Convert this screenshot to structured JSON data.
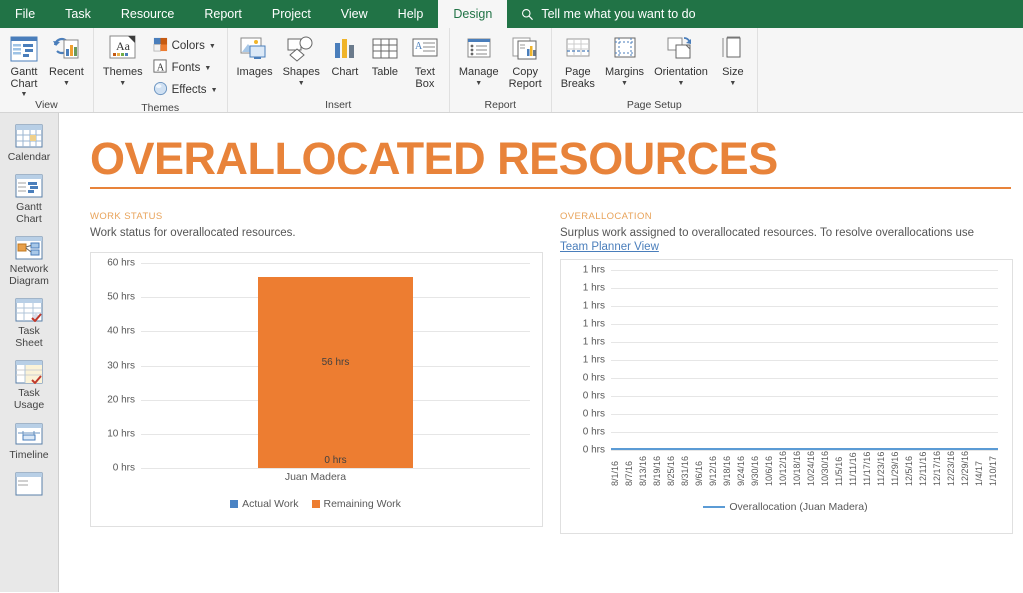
{
  "ribbon": {
    "tabs": [
      {
        "label": "File",
        "active": false
      },
      {
        "label": "Task",
        "active": false
      },
      {
        "label": "Resource",
        "active": false
      },
      {
        "label": "Report",
        "active": false
      },
      {
        "label": "Project",
        "active": false
      },
      {
        "label": "View",
        "active": false
      },
      {
        "label": "Help",
        "active": false
      },
      {
        "label": "Design",
        "active": true
      }
    ],
    "tell_me": "Tell me what you want to do",
    "tell_me_icon": "search-icon",
    "groups": [
      {
        "name": "View",
        "buttons": [
          {
            "label": "Gantt\nChart",
            "icon": "gantt-chart-icon",
            "dropdown": true
          },
          {
            "label": "Recent",
            "icon": "recent-icon",
            "dropdown": true
          }
        ]
      },
      {
        "name": "Themes",
        "buttons": [
          {
            "label": "Themes",
            "icon": "themes-icon",
            "dropdown": true
          }
        ],
        "small_buttons": [
          {
            "label": "Colors",
            "icon": "colors-icon",
            "dropdown": true
          },
          {
            "label": "Fonts",
            "icon": "fonts-icon",
            "dropdown": true
          },
          {
            "label": "Effects",
            "icon": "effects-icon",
            "dropdown": true
          }
        ]
      },
      {
        "name": "Insert",
        "buttons": [
          {
            "label": "Images",
            "icon": "images-icon",
            "dropdown": false
          },
          {
            "label": "Shapes",
            "icon": "shapes-icon",
            "dropdown": true
          },
          {
            "label": "Chart",
            "icon": "chart-icon",
            "dropdown": false
          },
          {
            "label": "Table",
            "icon": "table-icon",
            "dropdown": false
          },
          {
            "label": "Text\nBox",
            "icon": "text-box-icon",
            "dropdown": false
          }
        ]
      },
      {
        "name": "Report",
        "buttons": [
          {
            "label": "Manage",
            "icon": "manage-icon",
            "dropdown": true
          },
          {
            "label": "Copy\nReport",
            "icon": "copy-report-icon",
            "dropdown": false
          }
        ]
      },
      {
        "name": "Page Setup",
        "buttons": [
          {
            "label": "Page\nBreaks",
            "icon": "page-breaks-icon",
            "dropdown": false
          },
          {
            "label": "Margins",
            "icon": "margins-icon",
            "dropdown": true
          },
          {
            "label": "Orientation",
            "icon": "orientation-icon",
            "dropdown": true
          },
          {
            "label": "Size",
            "icon": "size-icon",
            "dropdown": true
          }
        ]
      }
    ]
  },
  "sidebar": {
    "items": [
      {
        "label": "Calendar",
        "icon": "calendar-view-icon"
      },
      {
        "label": "Gantt\nChart",
        "icon": "gantt-chart-view-icon"
      },
      {
        "label": "Network\nDiagram",
        "icon": "network-diagram-view-icon"
      },
      {
        "label": "Task\nSheet",
        "icon": "task-sheet-view-icon"
      },
      {
        "label": "Task\nUsage",
        "icon": "task-usage-view-icon"
      },
      {
        "label": "Timeline",
        "icon": "timeline-view-icon"
      },
      {
        "label": "",
        "icon": "partial-view-icon"
      }
    ]
  },
  "report": {
    "title": "OVERALLOCATED RESOURCES",
    "accent_color": "#E8833A",
    "panels": [
      {
        "heading": "WORK STATUS",
        "description": "Work status for overallocated resources.",
        "link": null
      },
      {
        "heading": "OVERALLOCATION",
        "description": "Surplus work assigned to overallocated resources. To resolve overallocations use",
        "link": "Team Planner View"
      }
    ]
  },
  "chart_data": [
    {
      "type": "bar",
      "title": "Work Status",
      "categories": [
        "Juan Madera"
      ],
      "series": [
        {
          "name": "Actual Work",
          "values": [
            0
          ],
          "color": "#4A83C4",
          "labels": [
            "0 hrs"
          ]
        },
        {
          "name": "Remaining Work",
          "values": [
            56
          ],
          "color": "#ED7D31",
          "labels": [
            "56 hrs"
          ]
        }
      ],
      "stacked": true,
      "ylabel": "",
      "xlabel": "",
      "ylim": [
        0,
        60
      ],
      "yticks": [
        "0 hrs",
        "10 hrs",
        "20 hrs",
        "30 hrs",
        "40 hrs",
        "50 hrs",
        "60 hrs"
      ],
      "grid": true,
      "legend_position": "bottom"
    },
    {
      "type": "line",
      "title": "Overallocation",
      "x": [
        "8/1/16",
        "8/7/16",
        "8/13/16",
        "8/19/16",
        "8/25/16",
        "8/31/16",
        "9/6/16",
        "9/12/16",
        "9/18/16",
        "9/24/16",
        "9/30/16",
        "10/6/16",
        "10/12/16",
        "10/18/16",
        "10/24/16",
        "10/30/16",
        "11/5/16",
        "11/11/16",
        "11/17/16",
        "11/23/16",
        "11/29/16",
        "12/5/16",
        "12/11/16",
        "12/17/16",
        "12/23/16",
        "12/29/16",
        "1/4/17",
        "1/10/17"
      ],
      "series": [
        {
          "name": "Overallocation (Juan Madera)",
          "color": "#5B9BD5",
          "values": [
            0,
            0,
            0,
            0,
            0,
            0,
            0,
            0,
            0,
            0,
            0,
            0,
            0,
            0,
            0,
            0,
            0,
            0,
            0,
            0,
            0,
            0,
            0,
            0,
            0,
            0,
            0,
            0
          ]
        }
      ],
      "ylabel": "",
      "xlabel": "",
      "ylim": [
        0,
        1
      ],
      "yticks": [
        "0 hrs",
        "0 hrs",
        "0 hrs",
        "0 hrs",
        "0 hrs",
        "1 hrs",
        "1 hrs",
        "1 hrs",
        "1 hrs",
        "1 hrs",
        "1 hrs"
      ],
      "grid": true,
      "legend_position": "bottom"
    }
  ]
}
